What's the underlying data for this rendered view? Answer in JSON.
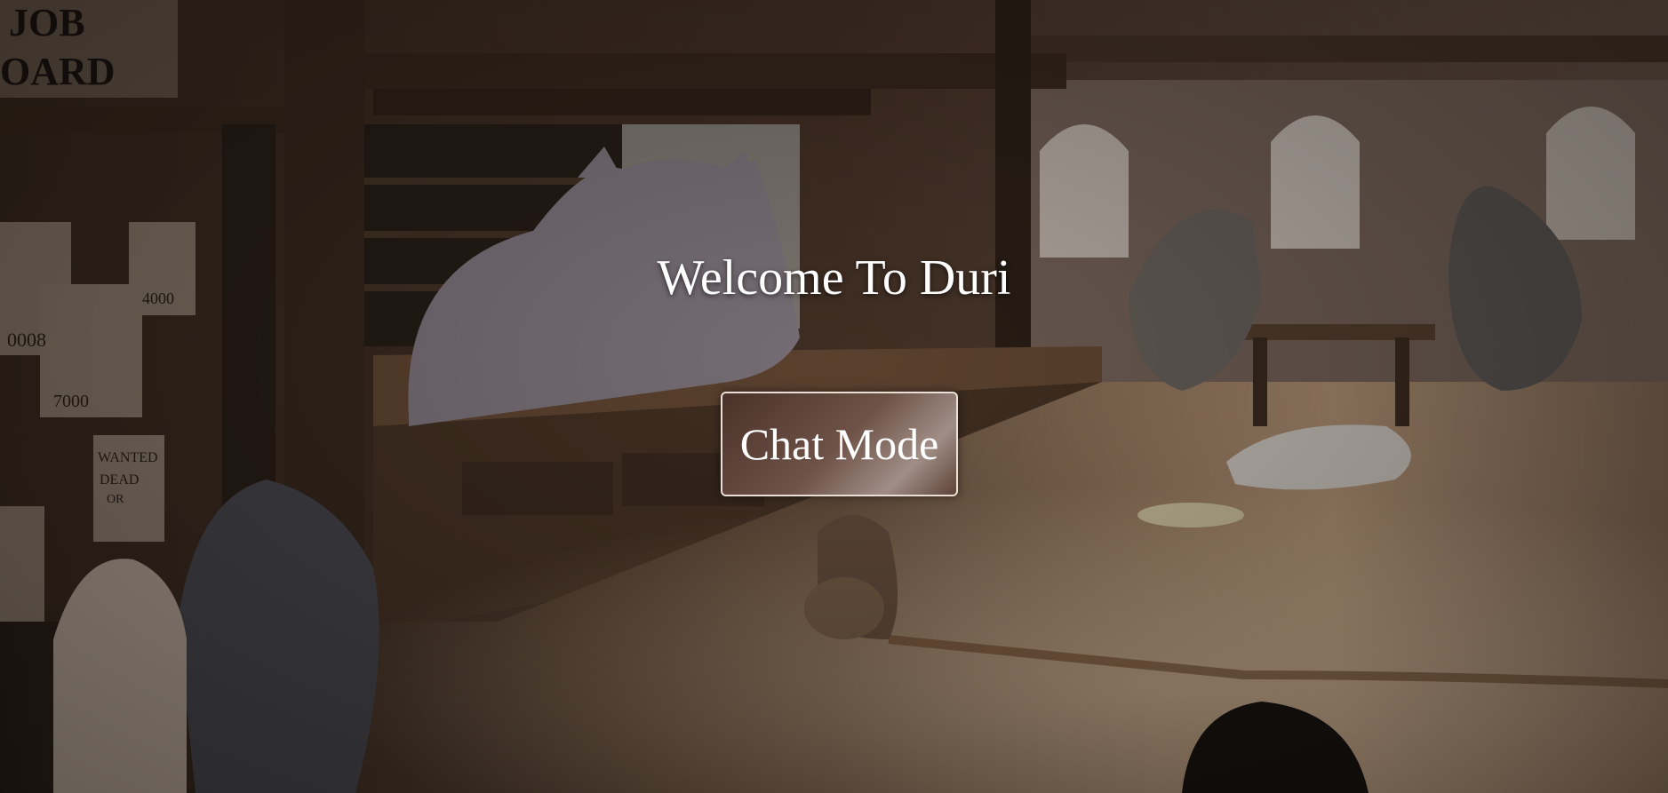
{
  "page": {
    "title": "Welcome To Duri",
    "chat_button_label": "Chat Mode"
  },
  "scene": {
    "description_signs": {
      "job_board_line1": "JOB",
      "job_board_line2": "OARD",
      "wanted_line1": "WANTED",
      "wanted_line2": "DEAD",
      "wanted_line3": "OR",
      "poster_bounty_1": "4000",
      "poster_bounty_2": "7000",
      "poster_bounty_3": "0008"
    },
    "colors": {
      "wood_dark": "#2b1d14",
      "wood_mid": "#5a3f2c",
      "wood_light": "#8a6a4e",
      "floor_light": "#c8a77f",
      "window_light": "#e8ddd0"
    }
  }
}
